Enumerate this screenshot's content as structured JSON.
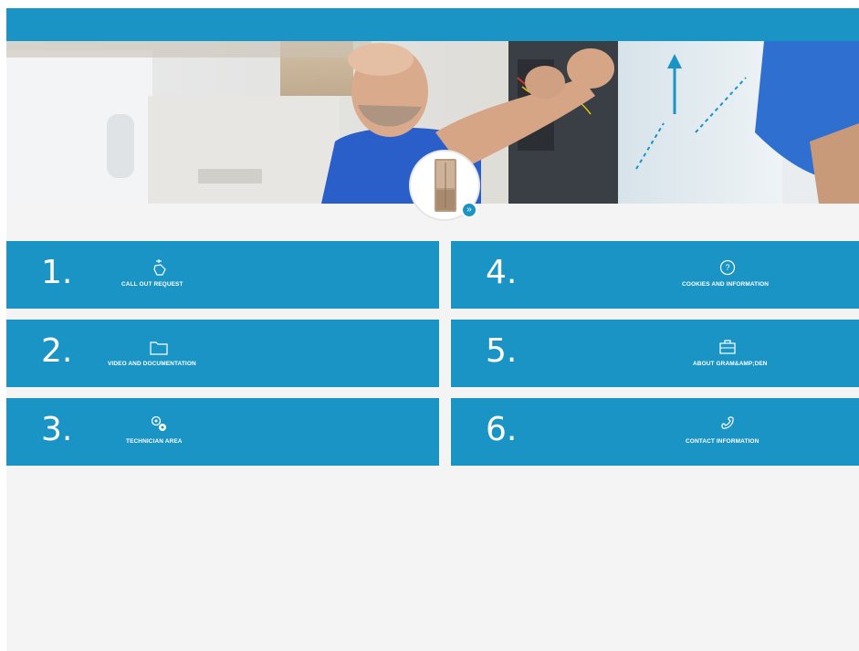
{
  "colors": {
    "brand": "#1a94c4",
    "background": "#f4f4f4",
    "tile_text": "#ffffff"
  },
  "hero": {
    "description_icon": "technician-photo",
    "product_thumb_icon": "fridge-photo",
    "badge_label": "»"
  },
  "tiles": [
    {
      "number": "1.",
      "label": "CALL OUT REQUEST",
      "icon": "hand-tap-icon"
    },
    {
      "number": "2.",
      "label": "VIDEO AND DOCUMENTATION",
      "icon": "folder-icon"
    },
    {
      "number": "3.",
      "label": "TECHNICIAN AREA",
      "icon": "gears-icon"
    },
    {
      "number": "4.",
      "label": "COOKIES AND INFORMATION",
      "icon": "question-circle-icon"
    },
    {
      "number": "5.",
      "label": "ABOUT GRAM&AMP;DEN",
      "icon": "briefcase-icon"
    },
    {
      "number": "6.",
      "label": "CONTACT INFORMATION",
      "icon": "phone-icon"
    }
  ]
}
